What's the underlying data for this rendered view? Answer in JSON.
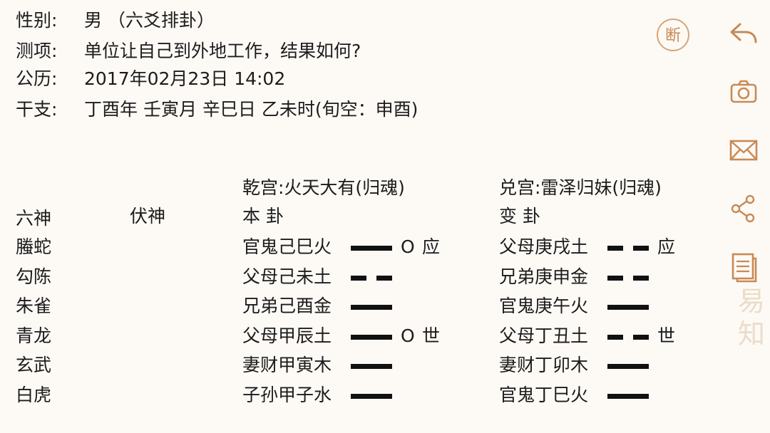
{
  "info": {
    "gender_label": "性别:",
    "gender_value": "男 （六爻排卦）",
    "question_label": "测项:",
    "question_value": "单位让自己到外地工作，结果如何?",
    "date_label": "公历:",
    "date_value": "2017年02月23日 14:02",
    "ganzhi_label": "干支:",
    "ganzhi_value": "丁酉年 壬寅月 辛巳日 乙未时(旬空：申酉)"
  },
  "table": {
    "header_liushen": "六神",
    "header_fushen": "伏神",
    "ben_gong": "乾宫:火天大有(归魂)",
    "ben_label": "本 卦",
    "bian_gong": "兑宫:雷泽归妹(归魂)",
    "bian_label": "变 卦",
    "rows": [
      {
        "liushen": "螣蛇",
        "ben": "官鬼己巳火",
        "ben_yao": "yang",
        "ben_mark": "O",
        "ben_shiying": "应",
        "bian": "父母庚戌土",
        "bian_yao": "yin",
        "bian_shiying": "应"
      },
      {
        "liushen": "勾陈",
        "ben": "父母己未土",
        "ben_yao": "yin",
        "ben_mark": "",
        "ben_shiying": "",
        "bian": "兄弟庚申金",
        "bian_yao": "yin",
        "bian_shiying": ""
      },
      {
        "liushen": "朱雀",
        "ben": "兄弟己酉金",
        "ben_yao": "yang",
        "ben_mark": "",
        "ben_shiying": "",
        "bian": "官鬼庚午火",
        "bian_yao": "yang",
        "bian_shiying": ""
      },
      {
        "liushen": "青龙",
        "ben": "父母甲辰土",
        "ben_yao": "yang",
        "ben_mark": "O",
        "ben_shiying": "世",
        "bian": "父母丁丑土",
        "bian_yao": "yin",
        "bian_shiying": "世"
      },
      {
        "liushen": "玄武",
        "ben": "妻财甲寅木",
        "ben_yao": "yang",
        "ben_mark": "",
        "ben_shiying": "",
        "bian": "妻财丁卯木",
        "bian_yao": "yang",
        "bian_shiying": ""
      },
      {
        "liushen": "白虎",
        "ben": "子孙甲子水",
        "ben_yao": "yang",
        "ben_mark": "",
        "ben_shiying": "",
        "bian": "官鬼丁巳火",
        "bian_yao": "yang",
        "bian_shiying": ""
      }
    ]
  },
  "toolbar": {
    "duan_label": "断",
    "icons": [
      "back-arrow-icon",
      "camera-icon",
      "mail-icon",
      "share-icon",
      "document-icon"
    ]
  },
  "watermark": "易知",
  "colors": {
    "accent": "#c88a55",
    "accent_light": "#d7a878",
    "line": "#111111",
    "background": "#fdfaf6"
  }
}
